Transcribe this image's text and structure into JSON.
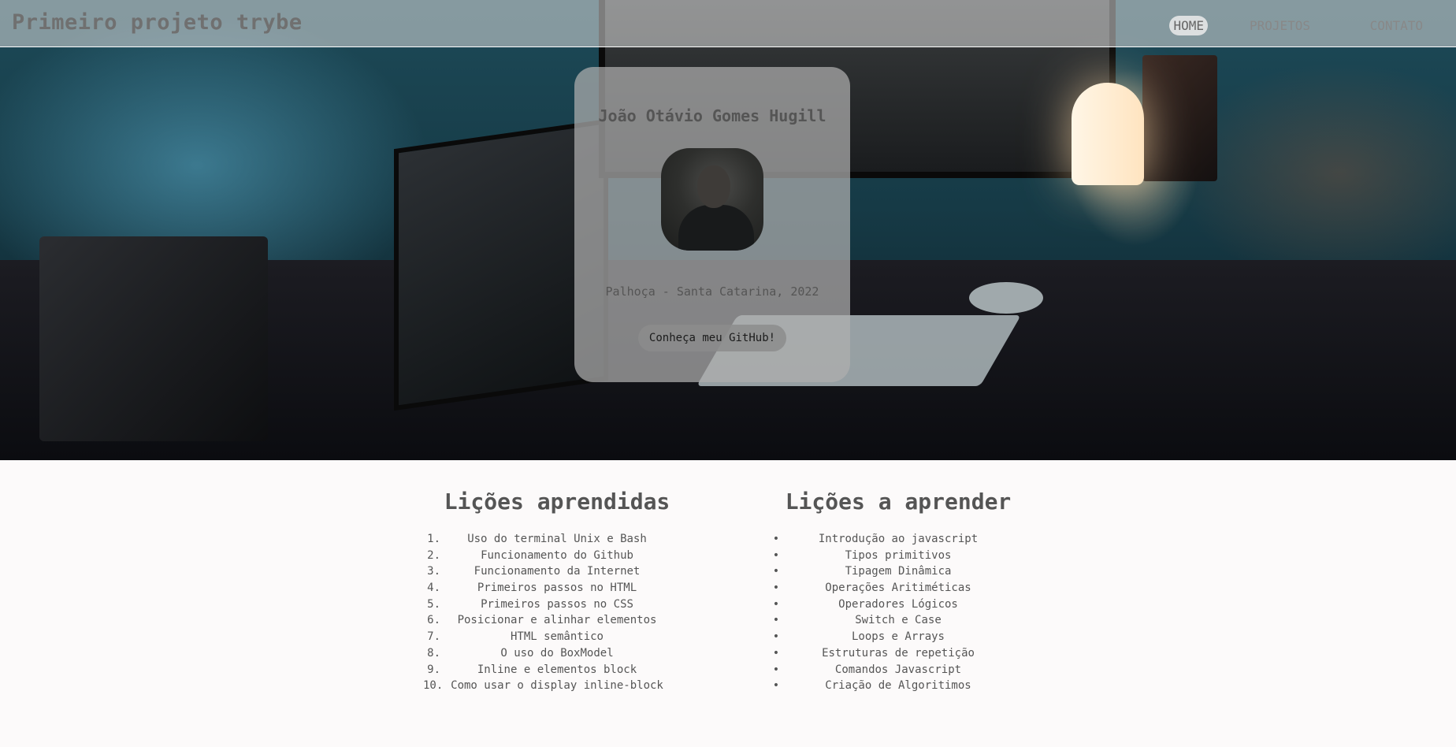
{
  "header": {
    "site_title": "Primeiro projeto trybe",
    "nav": [
      {
        "label": "HOME",
        "active": true
      },
      {
        "label": "PROJETOS",
        "active": false
      },
      {
        "label": "CONTATO",
        "active": false
      }
    ]
  },
  "profile": {
    "name": "João Otávio Gomes Hugill",
    "location": "Palhoça - Santa Catarina, 2022",
    "github_button": "Conheça meu GitHub!"
  },
  "learned": {
    "title": "Lições aprendidas",
    "items": [
      {
        "marker": "1.",
        "text": "Uso do terminal Unix e Bash"
      },
      {
        "marker": "2.",
        "text": "Funcionamento do Github"
      },
      {
        "marker": "3.",
        "text": "Funcionamento da Internet"
      },
      {
        "marker": "4.",
        "text": "Primeiros passos no HTML"
      },
      {
        "marker": "5.",
        "text": "Primeiros passos no CSS"
      },
      {
        "marker": "6.",
        "text": "Posicionar e alinhar elementos"
      },
      {
        "marker": "7.",
        "text": "HTML semântico"
      },
      {
        "marker": "8.",
        "text": "O uso do BoxModel"
      },
      {
        "marker": "9.",
        "text": "Inline e elementos block"
      },
      {
        "marker": "10.",
        "text": "Como usar o display inline-block"
      }
    ]
  },
  "to_learn": {
    "title": "Lições a aprender",
    "items": [
      {
        "marker": "•",
        "text": "Introdução ao javascript"
      },
      {
        "marker": "•",
        "text": "Tipos primitivos"
      },
      {
        "marker": "•",
        "text": "Tipagem Dinâmica"
      },
      {
        "marker": "•",
        "text": "Operações Aritiméticas"
      },
      {
        "marker": "•",
        "text": "Operadores Lógicos"
      },
      {
        "marker": "•",
        "text": "Switch e Case"
      },
      {
        "marker": "•",
        "text": "Loops e Arrays"
      },
      {
        "marker": "•",
        "text": "Estruturas de repetição"
      },
      {
        "marker": "•",
        "text": "Comandos Javascript"
      },
      {
        "marker": "•",
        "text": "Criação de Algoritimos"
      }
    ]
  }
}
